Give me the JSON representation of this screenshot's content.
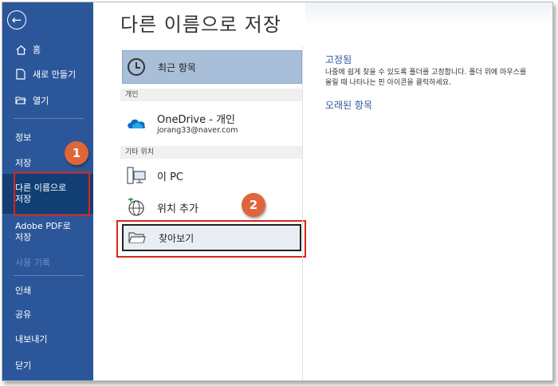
{
  "sidebar": {
    "back_icon": "back-arrow-icon",
    "items": [
      {
        "label": "홈",
        "icon": "home-icon"
      },
      {
        "label": "새로 만들기",
        "icon": "new-document-icon"
      },
      {
        "label": "열기",
        "icon": "open-folder-icon"
      },
      {
        "label": "정보"
      },
      {
        "label": "저장"
      },
      {
        "label": "다른 이름으로",
        "label2": "저장"
      },
      {
        "label": "Adobe PDF로",
        "label2": "저장"
      },
      {
        "label": "사용 기록"
      },
      {
        "label": "인쇄"
      },
      {
        "label": "공유"
      },
      {
        "label": "내보내기"
      },
      {
        "label": "닫기"
      }
    ]
  },
  "page_title": "다른 이름으로 저장",
  "locations": {
    "recent": "최근 항목",
    "personal_header": "개인",
    "onedrive_title": "OneDrive - 개인",
    "onedrive_email": "jorang33@naver.com",
    "other_header": "기타 위치",
    "this_pc": "이 PC",
    "add_location": "위치 추가",
    "browse": "찾아보기"
  },
  "pinned": {
    "title": "고정됨",
    "description": "나중에 쉽게 찾을 수 있도록 폴더를 고정합니다. 폴더 위에 마우스를 올릴 때 나타나는 핀 아이콘을 클릭하세요.",
    "older_title": "오래된 항목"
  },
  "annotations": {
    "badge1": "1",
    "badge2": "2"
  },
  "colors": {
    "sidebar": "#2b579a",
    "selected": "#123f73",
    "highlight": "#d9261c",
    "badge": "#e0653b"
  }
}
